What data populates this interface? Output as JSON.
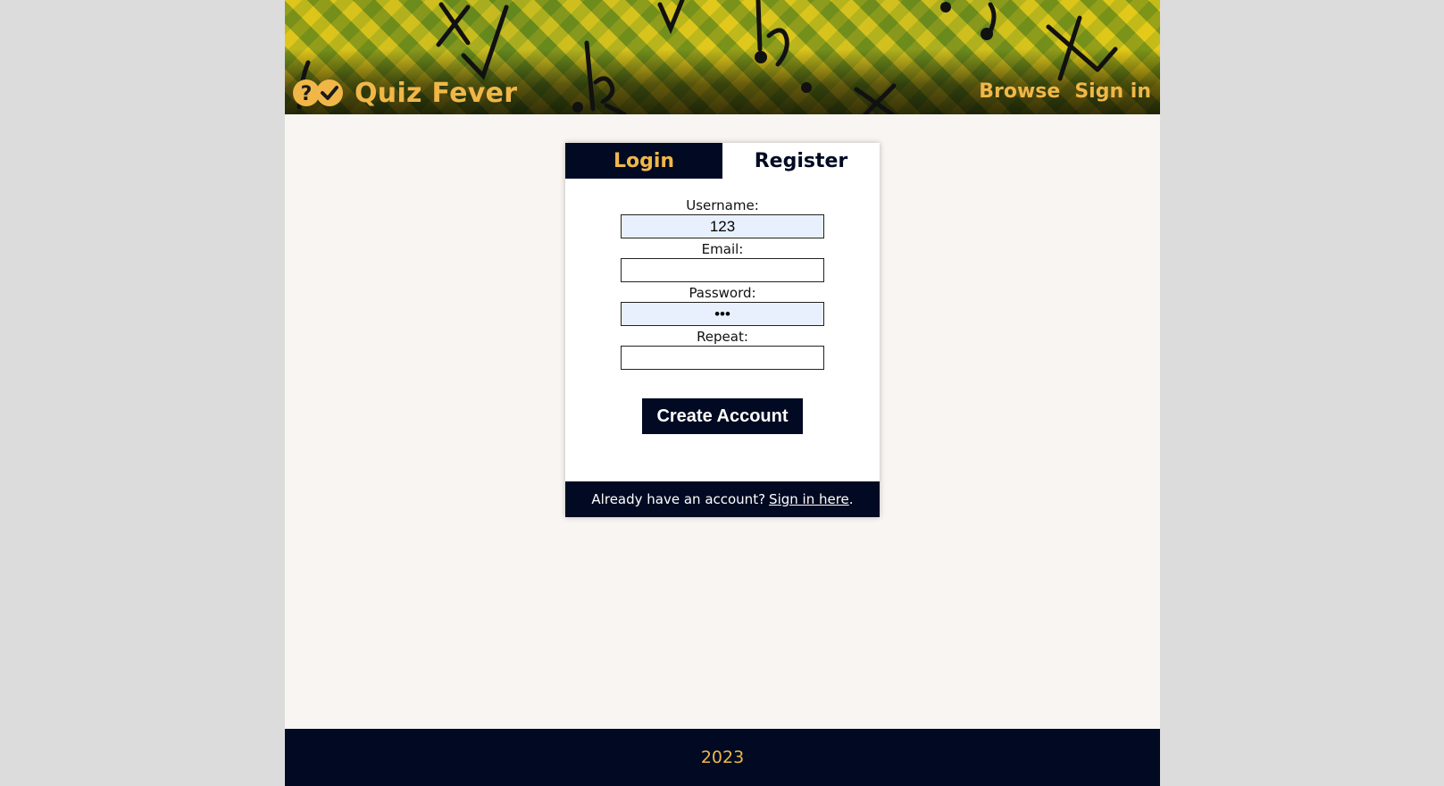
{
  "header": {
    "brand_name": "Quiz Fever",
    "logo_icon": "question-check-icon",
    "nav": [
      {
        "label": "Browse"
      },
      {
        "label": "Sign in"
      }
    ]
  },
  "auth": {
    "tabs": [
      {
        "label": "Login",
        "active": false
      },
      {
        "label": "Register",
        "active": true
      }
    ],
    "fields": {
      "username": {
        "label": "Username:",
        "value": "123"
      },
      "email": {
        "label": "Email:",
        "value": ""
      },
      "password": {
        "label": "Password:",
        "value": "123"
      },
      "repeat": {
        "label": "Repeat:",
        "value": ""
      }
    },
    "submit_label": "Create Account",
    "footer": {
      "prompt": "Already have an account?",
      "link": "Sign in here",
      "suffix": "."
    }
  },
  "footer": {
    "text": "2023"
  },
  "colors": {
    "navy": "#010a22",
    "gold": "#f0b748",
    "page_bg": "#f8f5f2",
    "outer_bg": "#dcdcdc"
  }
}
